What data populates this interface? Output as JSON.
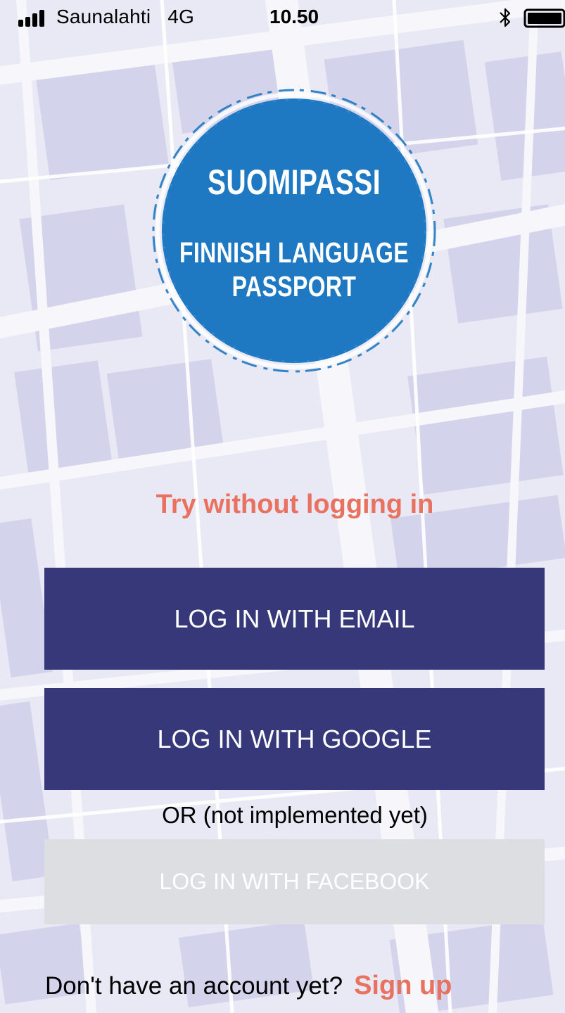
{
  "status_bar": {
    "carrier": "Saunalahti",
    "network": "4G",
    "time": "10.50",
    "signal_icon": "signal-bars-icon",
    "bluetooth_icon": "bluetooth-icon",
    "battery_icon": "battery-icon",
    "battery_level": 1.0
  },
  "logo": {
    "title": "SUOMIPASSI",
    "subtitle_line1": "FINNISH LANGUAGE",
    "subtitle_line2": "PASSPORT",
    "color": "#1e78c2"
  },
  "try_without_login": "Try without logging in",
  "buttons": {
    "email": "LOG IN WITH EMAIL",
    "google": "LOG IN WITH GOOGLE",
    "facebook": "LOG IN WITH FACEBOOK"
  },
  "or_text": "OR (not implemented yet)",
  "footer": {
    "prompt": "Don't have an account yet?",
    "signup": "Sign up"
  },
  "colors": {
    "primary_button": "#36387a",
    "accent": "#e8725f",
    "disabled_button": "#dcdee1",
    "map_background": "#e7e7f3"
  }
}
